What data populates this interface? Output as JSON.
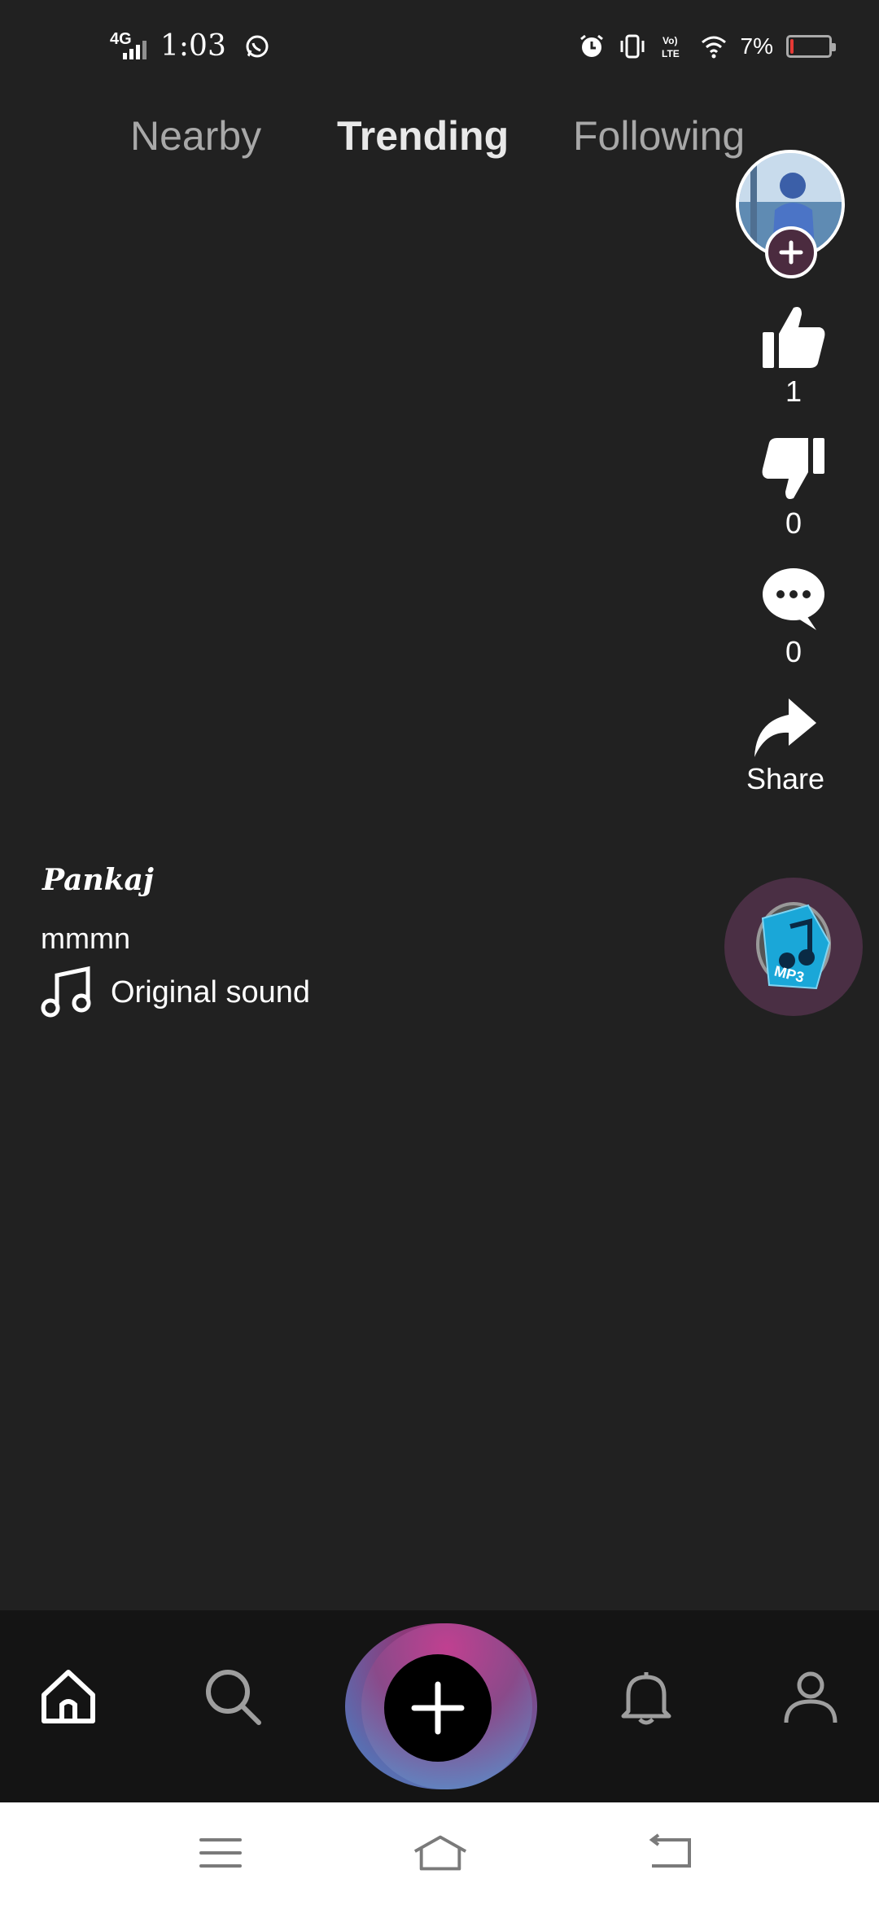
{
  "status_bar": {
    "network": "4G",
    "time": "1:03",
    "battery_percent": "7%",
    "battery_level": 0.07,
    "icons": [
      "signal-icon",
      "whatsapp-icon",
      "alarm-icon",
      "vibrate-icon",
      "volte-icon",
      "wifi-icon",
      "battery-icon"
    ]
  },
  "tabs": [
    {
      "label": "Nearby",
      "active": false
    },
    {
      "label": "Trending",
      "active": true
    },
    {
      "label": "Following",
      "active": false
    }
  ],
  "actions": {
    "likes": "1",
    "dislikes": "0",
    "comments": "0",
    "share_label": "Share"
  },
  "post": {
    "username": "Pankaj",
    "caption": "mmmn",
    "sound": "Original sound",
    "disc_label": "MP3"
  },
  "bottom_nav": [
    "home-icon",
    "search-icon",
    "create-icon",
    "bell-icon",
    "profile-icon"
  ],
  "system_nav": [
    "menu-icon",
    "home-icon",
    "back-icon"
  ],
  "colors": {
    "background": "#212121",
    "nav_background": "#141414",
    "accent_pink": "#b23a8a",
    "accent_blue": "#4f86c6",
    "disc_background": "#4a2f44"
  }
}
